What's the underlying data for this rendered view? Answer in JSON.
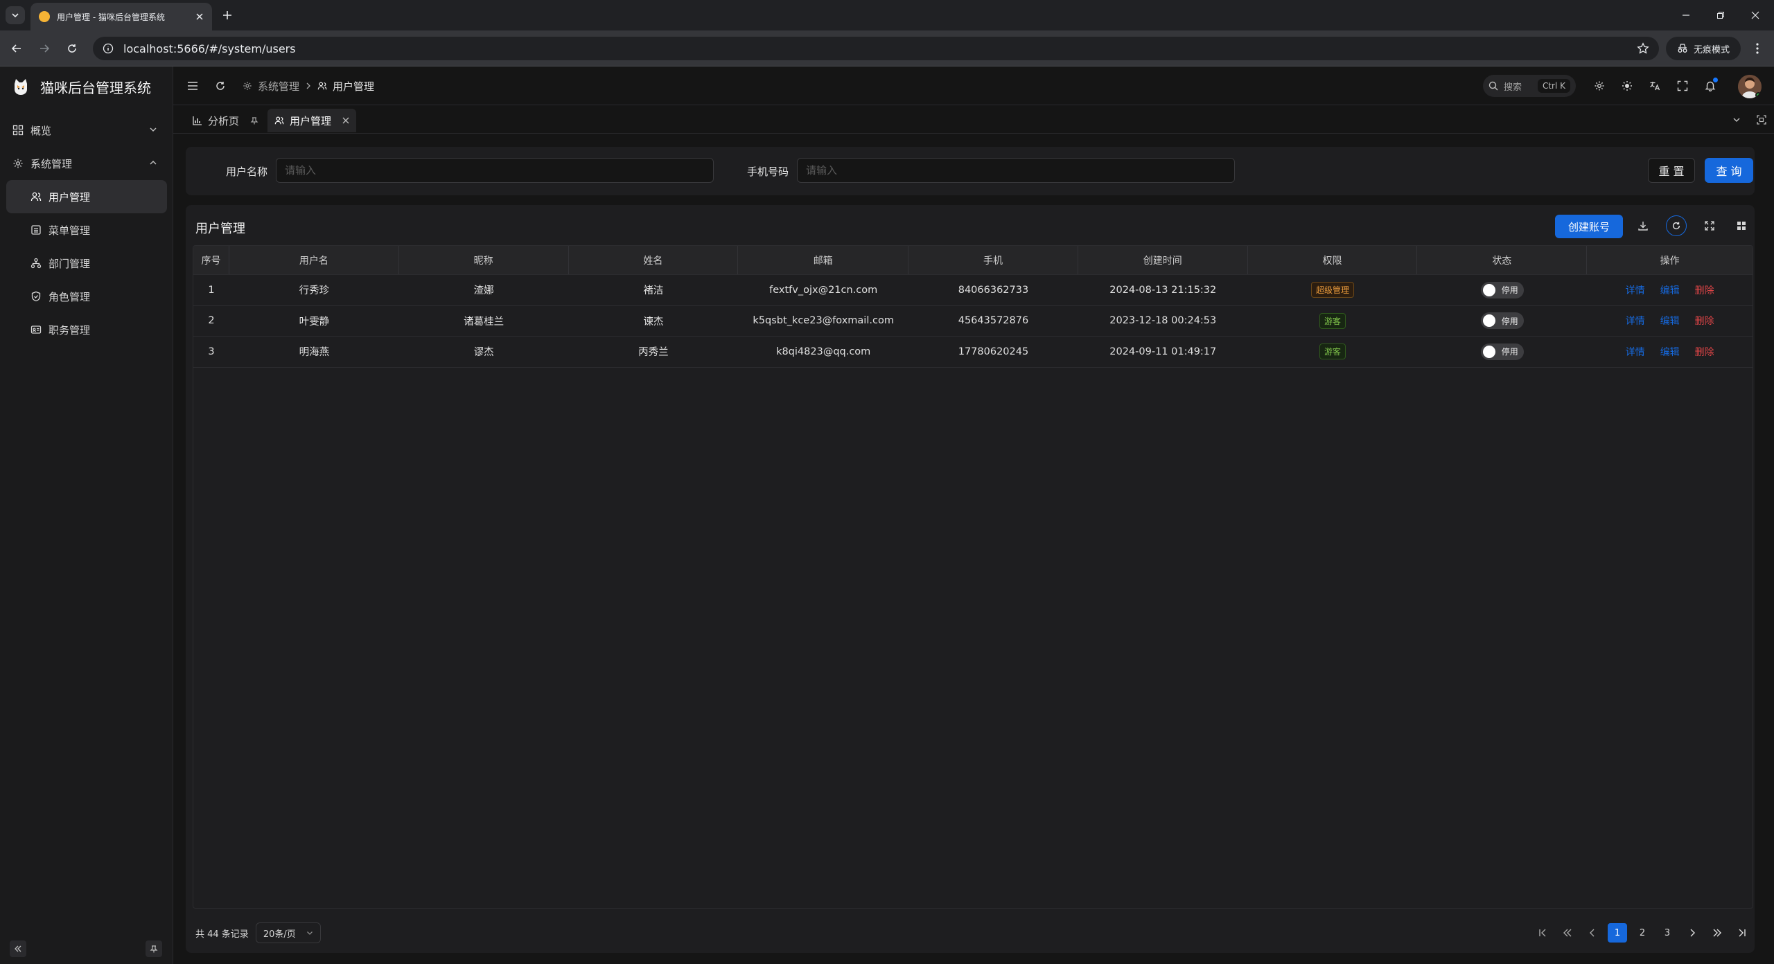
{
  "browser": {
    "tab_title": "用户管理 - 猫咪后台管理系统",
    "url": "localhost:5666/#/system/users",
    "incognito_label": "无痕模式"
  },
  "app": {
    "brand": "猫咪后台管理系统",
    "sidebar": {
      "items": [
        {
          "label": "概览",
          "icon": "dashboard-icon"
        },
        {
          "label": "系统管理",
          "icon": "gear-icon"
        },
        {
          "label": "用户管理",
          "icon": "users-icon"
        },
        {
          "label": "菜单管理",
          "icon": "menu-list-icon"
        },
        {
          "label": "部门管理",
          "icon": "org-icon"
        },
        {
          "label": "角色管理",
          "icon": "shield-icon"
        },
        {
          "label": "职务管理",
          "icon": "id-card-icon"
        }
      ]
    },
    "breadcrumb": {
      "parent": "系统管理",
      "current": "用户管理"
    },
    "search": {
      "label": "搜索",
      "shortcut": "Ctrl K"
    },
    "tabs": [
      {
        "label": "分析页"
      },
      {
        "label": "用户管理"
      }
    ]
  },
  "filter": {
    "username_label": "用户名称",
    "username_placeholder": "请输入",
    "phone_label": "手机号码",
    "phone_placeholder": "请输入",
    "reset_label": "重 置",
    "query_label": "查 询"
  },
  "panel": {
    "title": "用户管理",
    "create_label": "创建账号"
  },
  "table": {
    "columns": [
      "序号",
      "用户名",
      "昵称",
      "姓名",
      "邮箱",
      "手机",
      "创建时间",
      "权限",
      "状态",
      "操作"
    ],
    "rows": [
      {
        "no": "1",
        "username": "行秀珍",
        "nickname": "渣娜",
        "name": "褚洁",
        "email": "fextfv_ojx@21cn.com",
        "phone": "84066362733",
        "created": "2024-08-13 21:15:32",
        "role": "超级管理",
        "status": "停用"
      },
      {
        "no": "2",
        "username": "叶雯静",
        "nickname": "诸葛桂兰",
        "name": "谏杰",
        "email": "k5qsbt_kce23@foxmail.com",
        "phone": "45643572876",
        "created": "2023-12-18 00:24:53",
        "role": "游客",
        "status": "停用"
      },
      {
        "no": "3",
        "username": "明海燕",
        "nickname": "谬杰",
        "name": "丙秀兰",
        "email": "k8qi4823@qq.com",
        "phone": "17780620245",
        "created": "2024-09-11 01:49:17",
        "role": "游客",
        "status": "停用"
      }
    ],
    "actions": {
      "detail": "详情",
      "edit": "编辑",
      "delete": "删除"
    }
  },
  "pagination": {
    "total_text": "共 44 条记录",
    "page_size": "20条/页",
    "pages": [
      "1",
      "2",
      "3"
    ],
    "current_page": "1"
  },
  "colors": {
    "primary": "#1668dc",
    "danger": "#dc4446",
    "admin_tag": "#e89a3c",
    "guest_tag": "#7fc24a"
  }
}
